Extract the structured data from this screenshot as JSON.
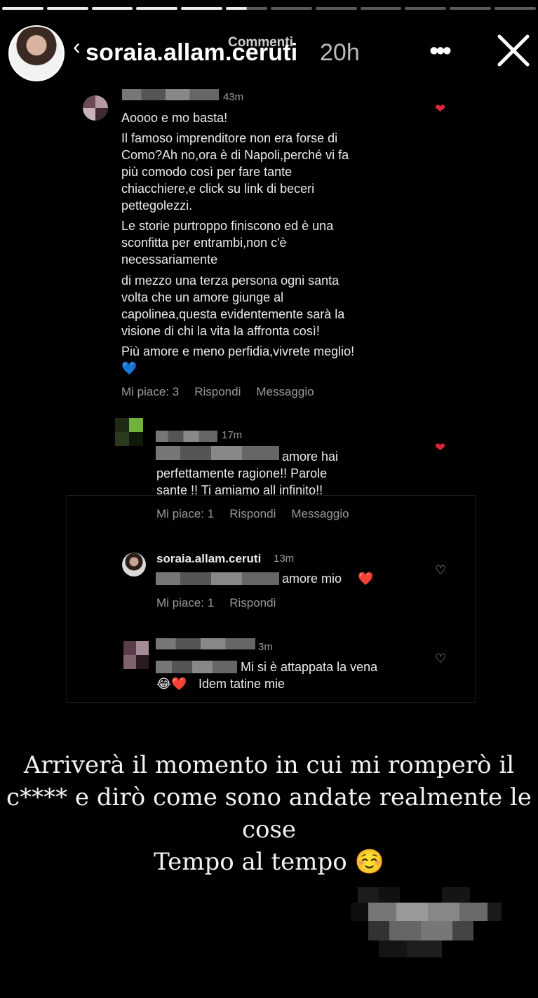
{
  "progress": {
    "total": 12,
    "completed": 5,
    "active_fraction": 0.5
  },
  "header": {
    "caption": "Commenti",
    "username": "soraia.allam.ceruti",
    "time": "20h",
    "back_icon": "chevron-left-icon",
    "more_icon": "more-horizontal-icon",
    "close_icon": "close-icon"
  },
  "comment1": {
    "time": "43m",
    "paragraphs": [
      "Aoooo e mo basta!",
      "Il famoso imprenditore non era forse di",
      "Como?Ah no,ora è di Napoli,perché vi fa",
      "più comodo così per fare tante",
      "chiacchiere,e click su link di beceri",
      "pettegolezzi.",
      "Le storie purtroppo finiscono ed è una",
      "sconfitta per entrambi,non c'è",
      "necessariamente",
      "di mezzo una terza persona ogni santa",
      "volta che un amore giunge al",
      "capolinea,questa evidentemente sarà la",
      "visione di chi la vita la affronta così!",
      "Più amore e meno perfidia,vivrete meglio!"
    ],
    "emoji": "💙",
    "likes": "Mi piace: 3",
    "reply": "Rispondi",
    "message": "Messaggio"
  },
  "comment2": {
    "time": "17m",
    "lines": [
      "amore hai",
      "perfettamente ragione!! Parole",
      "sante !! Ti amiamo all infinito!!"
    ],
    "likes": "Mi piace: 1",
    "reply": "Rispondi",
    "message": "Messaggio"
  },
  "comment3": {
    "username": "soraia.allam.ceruti",
    "time": "13m",
    "text": "amore mio",
    "emoji": "❤️",
    "likes": "Mi piace: 1",
    "reply": "Rispondi"
  },
  "comment4": {
    "time": "3m",
    "line1": "Mi si è attappata la vena",
    "emojis": "😂❤️",
    "line2": "Idem tatine mie"
  },
  "caption": {
    "line1": "Arriverà il momento in cui mi romperò il",
    "line2": "c**** e dirò come sono andate realmente le",
    "line3": "cose",
    "line4": "Tempo al tempo ☺️"
  }
}
